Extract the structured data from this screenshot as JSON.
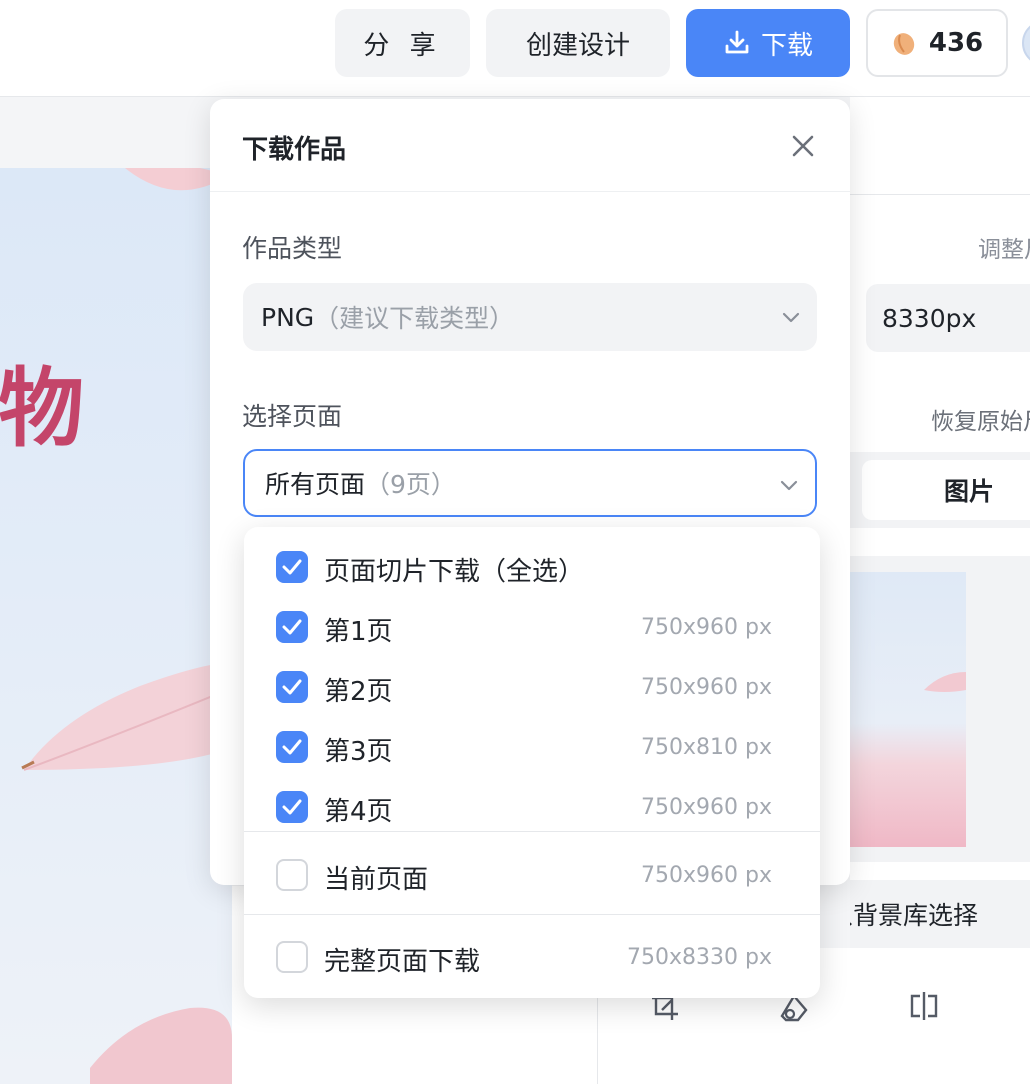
{
  "topbar": {
    "share_label": "分 享",
    "create_label": "创建设计",
    "download_label": "下载",
    "credits_value": "436"
  },
  "canvas": {
    "title_fragment": "物"
  },
  "modal": {
    "title": "下载作品",
    "type_label": "作品类型",
    "type_value": "PNG",
    "type_hint": "（建议下载类型）",
    "pages_label": "选择页面",
    "pages_value": "所有页面",
    "pages_hint": "（9页）"
  },
  "dropdown": {
    "select_all": {
      "label": "页面切片下载（全选）",
      "checked": true
    },
    "pages": [
      {
        "label": "第1页",
        "size": "750x960 px",
        "checked": true
      },
      {
        "label": "第2页",
        "size": "750x960 px",
        "checked": true
      },
      {
        "label": "第3页",
        "size": "750x810 px",
        "checked": true
      },
      {
        "label": "第4页",
        "size": "750x960 px",
        "checked": true
      }
    ],
    "current_page": {
      "label": "当前页面",
      "size": "750x960 px",
      "checked": false
    },
    "full_page": {
      "label": "完整页面下载",
      "size": "750x8330 px",
      "checked": false
    }
  },
  "right_panel": {
    "adjust_label": "调整尺寸",
    "height_value": "8330px",
    "restore_label": "恢复原始尺寸",
    "seg_active_label": "图片",
    "bg_library_label": "从背景库选择"
  },
  "colors": {
    "accent": "#4a86f7",
    "title_pink": "#c4456a"
  },
  "icons": [
    "download-icon",
    "bean-icon",
    "close-icon",
    "chevron-down-icon",
    "check-icon",
    "crop-icon",
    "erase-icon",
    "flip-icon"
  ]
}
